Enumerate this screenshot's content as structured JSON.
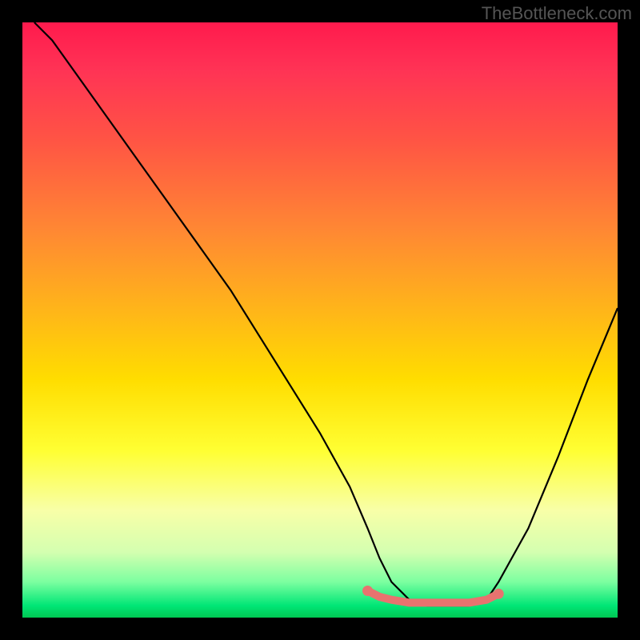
{
  "watermark": "TheBottleneck.com",
  "chart_data": {
    "type": "line",
    "title": "",
    "xlabel": "",
    "ylabel": "",
    "xlim": [
      0,
      100
    ],
    "ylim": [
      0,
      100
    ],
    "series": [
      {
        "name": "curve",
        "x": [
          2,
          5,
          10,
          15,
          20,
          25,
          30,
          35,
          40,
          45,
          50,
          55,
          58,
          60,
          62,
          65,
          68,
          72,
          75,
          78,
          80,
          85,
          90,
          95,
          100
        ],
        "y": [
          100,
          97,
          90,
          83,
          76,
          69,
          62,
          55,
          47,
          39,
          31,
          22,
          15,
          10,
          6,
          3,
          2,
          2,
          2,
          3,
          6,
          15,
          27,
          40,
          52
        ]
      }
    ],
    "highlight_segment": {
      "color": "#e8736f",
      "x": [
        58,
        60,
        62,
        65,
        68,
        72,
        75,
        78,
        80
      ],
      "y": [
        4.5,
        3.5,
        3,
        2.5,
        2.5,
        2.5,
        2.5,
        3,
        4
      ],
      "endpoints": {
        "left": {
          "x": 58,
          "y": 4.5
        },
        "right": {
          "x": 80,
          "y": 4
        }
      }
    }
  }
}
